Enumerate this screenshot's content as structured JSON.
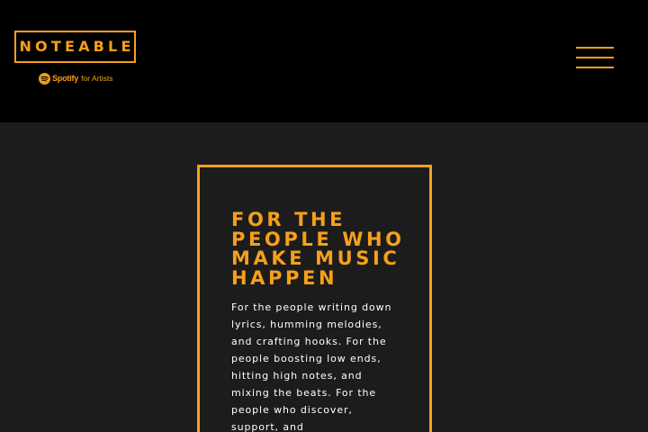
{
  "header": {
    "logo_text": "NOTEABLE",
    "partner_brand": "Spotify",
    "partner_suffix": "for Artists",
    "menu_icon": "hamburger-menu-icon"
  },
  "hero": {
    "title": "FOR THE PEOPLE WHO MAKE MUSIC HAPPEN",
    "body": "For the people writing down lyrics, humming melodies, and crafting hooks. For the people boosting low ends, hitting high notes, and mixing the beats. For the people who discover, support, and"
  },
  "colors": {
    "accent": "#f6a01a",
    "header_background": "#000000",
    "page_background": "#1c1c1c",
    "body_text": "#ffffff"
  }
}
